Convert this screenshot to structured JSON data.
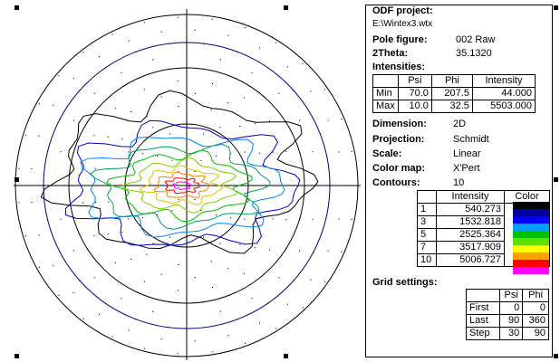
{
  "header": {
    "odf_project_label": "ODF project:",
    "odf_project_file": "E:\\Wintex3.wtx",
    "pole_figure_label": "Pole figure:",
    "pole_figure_value": "002 Raw",
    "two_theta_label": "2Theta:",
    "two_theta_value": "35.1320"
  },
  "intensities": {
    "title": "Intensities:",
    "columns": [
      "",
      "Psi",
      "Phi",
      "Intensity"
    ],
    "rows": [
      [
        "Min",
        "70.0",
        "207.5",
        "44.000"
      ],
      [
        "Max",
        "10.0",
        "32.5",
        "5503.000"
      ]
    ]
  },
  "settings": {
    "dimension_label": "Dimension:",
    "dimension_value": "2D",
    "projection_label": "Projection:",
    "projection_value": "Schmidt",
    "scale_label": "Scale:",
    "scale_value": "Linear",
    "color_map_label": "Color map:",
    "color_map_value": "X'Pert",
    "contours_label": "Contours:",
    "contours_value": "10"
  },
  "contours_table": {
    "columns": [
      "",
      "Intensity",
      "Color"
    ],
    "rows": [
      [
        "1",
        "540.273"
      ],
      [
        "3",
        "1532.818"
      ],
      [
        "5",
        "2525.364"
      ],
      [
        "7",
        "3517.909"
      ],
      [
        "10",
        "5006.727"
      ]
    ],
    "colormap": [
      "#000000",
      "#0000a0",
      "#0000ff",
      "#00a0ff",
      "#00c000",
      "#60e000",
      "#ffff00",
      "#ffa000",
      "#ff0000",
      "#ff00ff"
    ]
  },
  "grid_settings": {
    "title": "Grid settings:",
    "columns": [
      "",
      "Psi",
      "Phi"
    ],
    "rows": [
      [
        "First",
        "0",
        "0"
      ],
      [
        "Last",
        "90",
        "360"
      ],
      [
        "Step",
        "30",
        "90"
      ]
    ]
  },
  "plot": {
    "outline_color": "#000000",
    "psi_30_circle_color": "#000080",
    "contour_colors": [
      "#000000",
      "#0000c0",
      "#0080ff",
      "#00a060",
      "#00c000",
      "#80d000",
      "#e0c000",
      "#ff8000",
      "#ff0000",
      "#ff00ff"
    ]
  }
}
